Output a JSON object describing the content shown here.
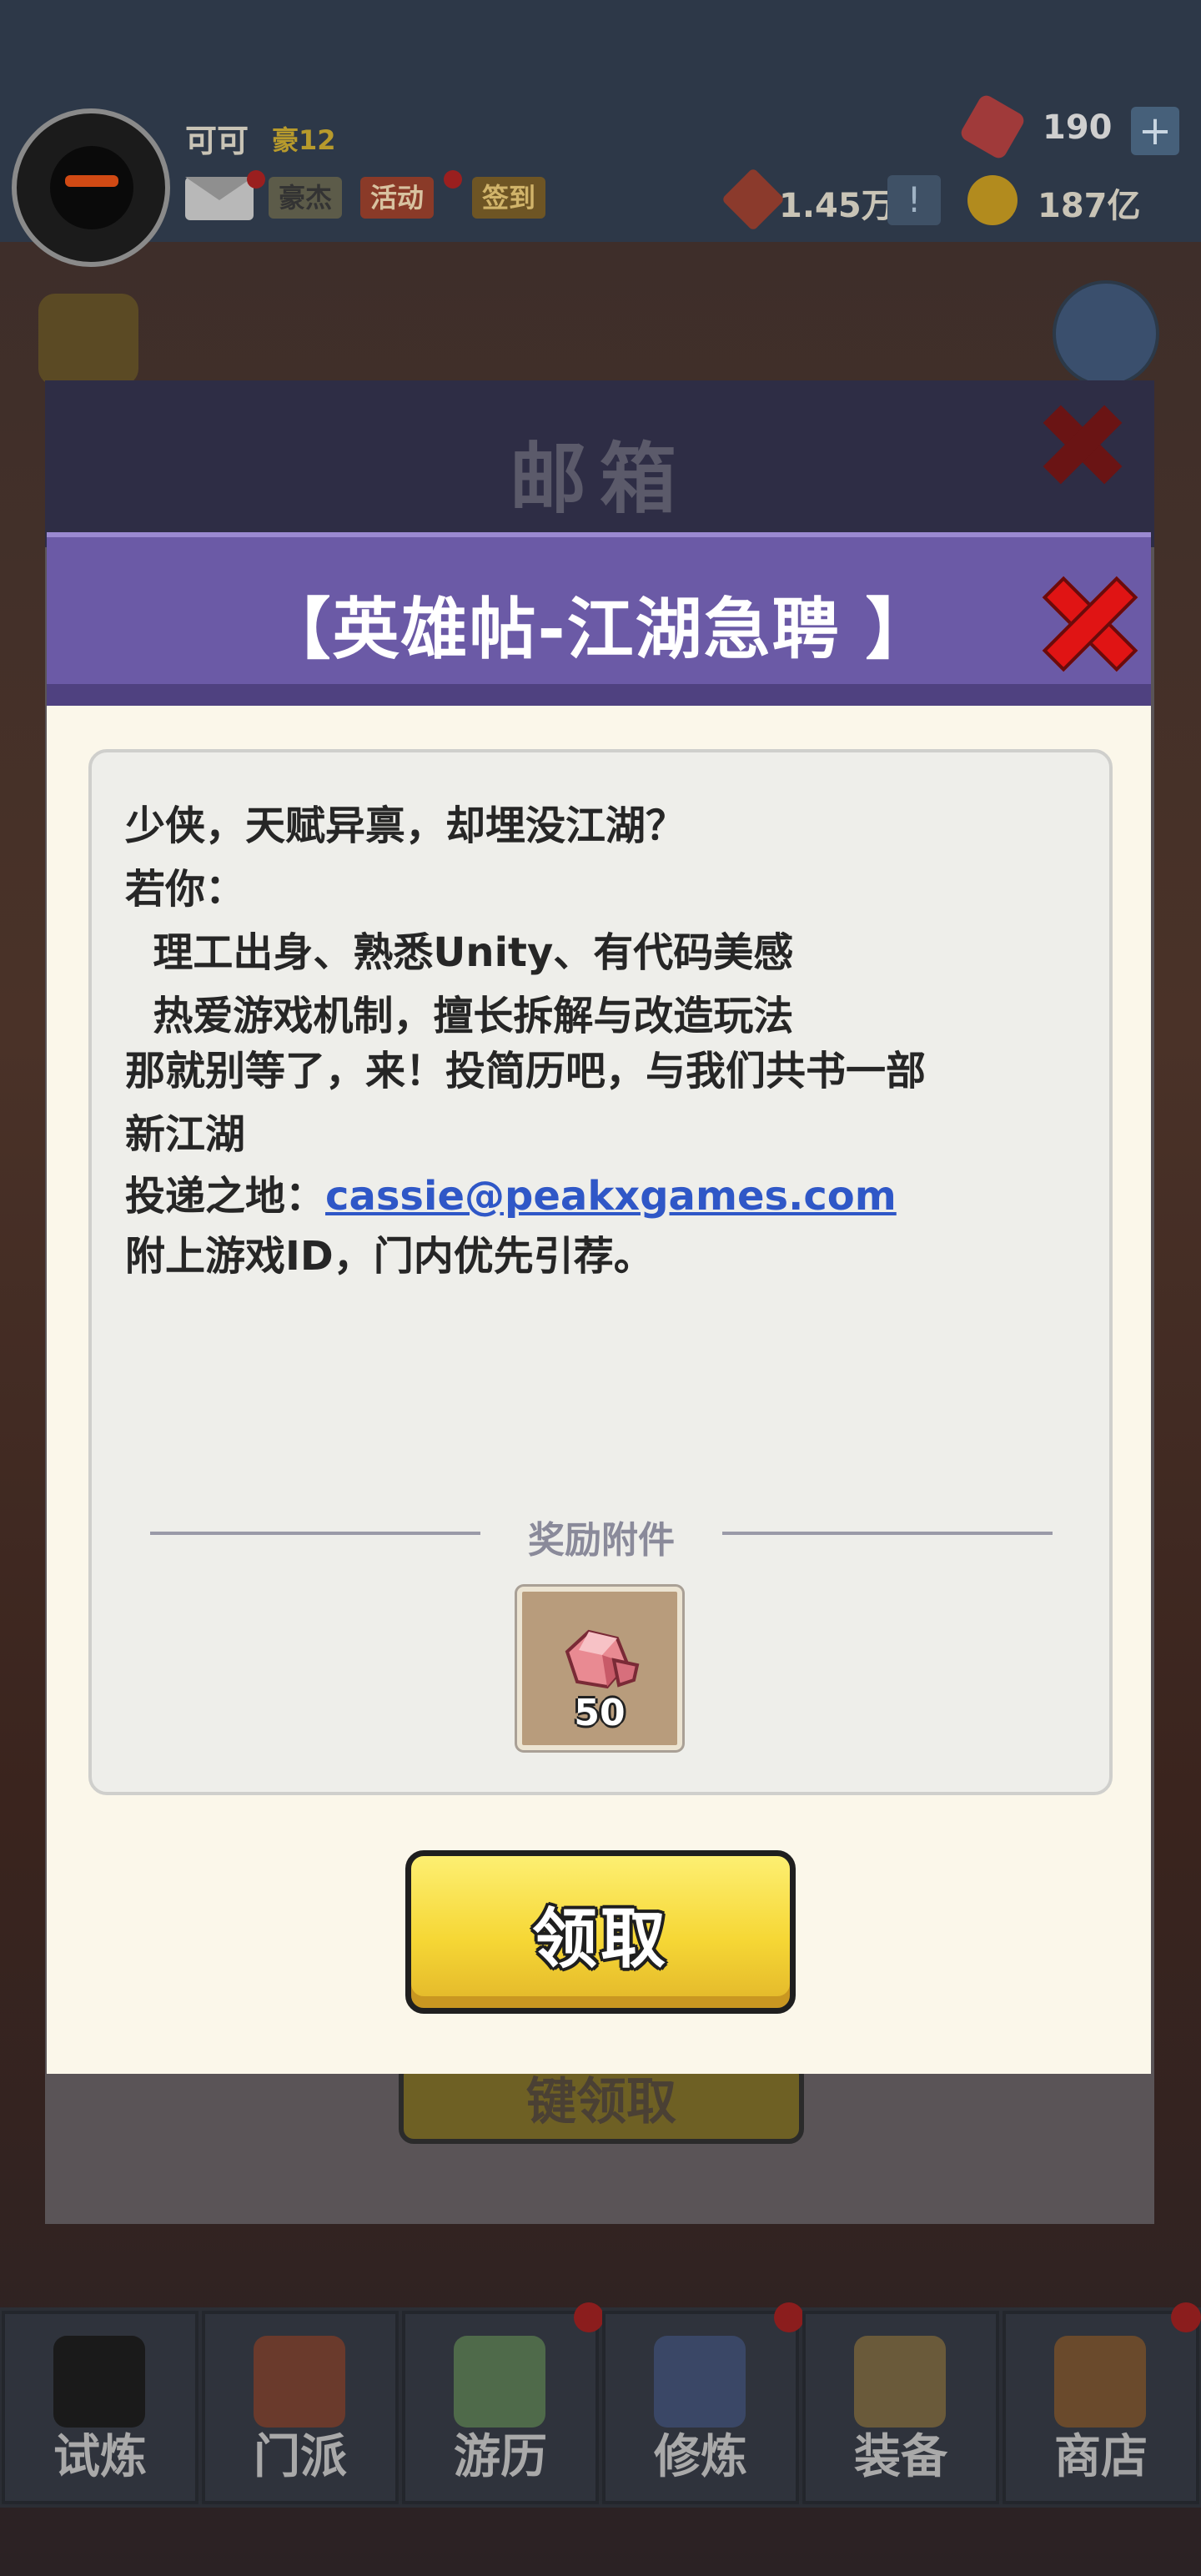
{
  "header": {
    "player_name": "可可",
    "rank": "豪12",
    "mail_icon": "mail-icon",
    "tags": [
      "豪杰",
      "活动",
      "签到"
    ],
    "gems": "190",
    "seal_value": "1.45万",
    "coins": "187亿",
    "plus": "+",
    "excl": "!"
  },
  "mailbox": {
    "title": "邮箱",
    "back_button": "键领取"
  },
  "modal": {
    "title": "【英雄帖-江湖急聘 】",
    "message": {
      "line1": "少侠，天赋异禀，却埋没江湖？",
      "line2": "若你：",
      "line3": "  理工出身、熟悉Unity、有代码美感",
      "line4": "  热爱游戏机制，擅长拆解与改造玩法",
      "line5": "那就别等了，来！投简历吧，与我们共书一部",
      "line6": "新江湖",
      "line7_prefix": "投递之地：",
      "email": "cassie@peakxgames.com",
      "line8": "附上游戏ID，门内优先引荐。"
    },
    "attachment_label": "奖励附件",
    "reward": {
      "icon": "gem-icon",
      "count": "50"
    },
    "claim_label": "领取"
  },
  "bottom_nav": {
    "items": [
      "试炼",
      "门派",
      "游历",
      "修炼",
      "装备",
      "商店"
    ]
  },
  "colors": {
    "header_purple": "#6b5aa6",
    "claim_yellow": "#f6d735",
    "close_red": "#e01414",
    "link_blue": "#2f57c7"
  }
}
